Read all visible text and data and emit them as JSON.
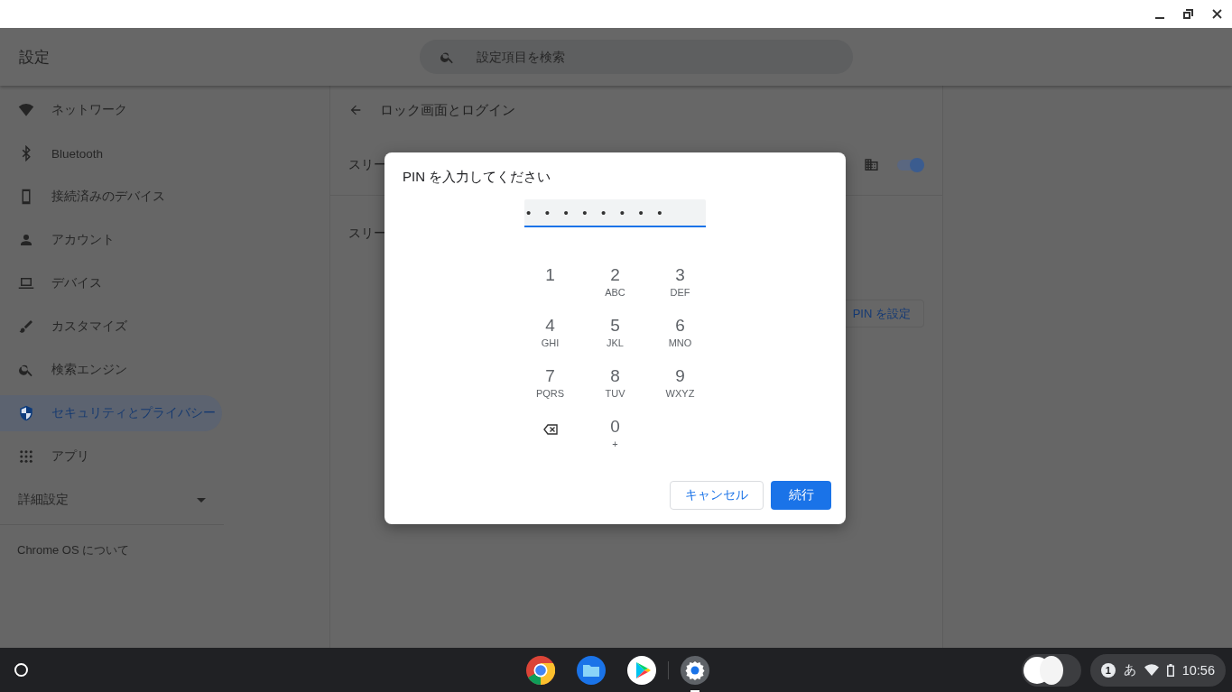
{
  "app": {
    "title": "設定",
    "search": {
      "placeholder": "設定項目を検索"
    }
  },
  "sidebar": {
    "items": [
      {
        "label": "ネットワーク",
        "selected": false
      },
      {
        "label": "Bluetooth",
        "selected": false
      },
      {
        "label": "接続済みのデバイス",
        "selected": false
      },
      {
        "label": "アカウント",
        "selected": false
      },
      {
        "label": "デバイス",
        "selected": false
      },
      {
        "label": "カスタマイズ",
        "selected": false
      },
      {
        "label": "検索エンジン",
        "selected": false
      },
      {
        "label": "セキュリティとプライバシー",
        "selected": true
      },
      {
        "label": "アプリ",
        "selected": false
      }
    ],
    "advanced": {
      "label": "詳細設定",
      "expanded": false
    },
    "about": "Chrome OS について"
  },
  "page": {
    "title": "ロック画面とログイン",
    "row_1": {
      "label": "スリー",
      "on": true
    },
    "row_2_label": "スリー",
    "button": "PIN を設定"
  },
  "dialog": {
    "title": "PIN を入力してください",
    "pin": {
      "value": "••••••••"
    },
    "keys": [
      {
        "kind": "digit",
        "digit": "1"
      },
      {
        "kind": "digit",
        "digit": "2",
        "letters": "ABC"
      },
      {
        "kind": "digit",
        "digit": "3",
        "letters": "DEF"
      },
      {
        "kind": "digit",
        "digit": "4",
        "letters": "GHI"
      },
      {
        "kind": "digit",
        "digit": "5",
        "letters": "JKL"
      },
      {
        "kind": "digit",
        "digit": "6",
        "letters": "MNO"
      },
      {
        "kind": "digit",
        "digit": "7",
        "letters": "PQRS"
      },
      {
        "kind": "digit",
        "digit": "8",
        "letters": "TUV"
      },
      {
        "kind": "digit",
        "digit": "9",
        "letters": "WXYZ"
      },
      {
        "kind": "backspace"
      },
      {
        "kind": "digit",
        "digit": "0",
        "letters": "+"
      }
    ],
    "buttons": [
      {
        "label": "キャンセル",
        "kind": "secondary"
      },
      {
        "label": "続行",
        "kind": "primary"
      }
    ]
  },
  "shelf": [
    {
      "running": false
    },
    {
      "running": false
    },
    {
      "running": false
    },
    {
      "running": true
    }
  ],
  "status": {
    "notification_count": "1",
    "ime": "あ",
    "time": "10:56"
  }
}
